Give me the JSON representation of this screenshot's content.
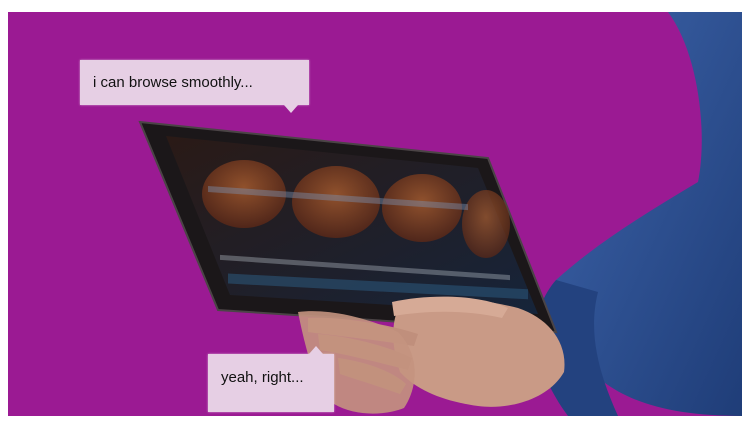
{
  "photo": {
    "background_color": "#9b1a93",
    "sleeve_color": "#2a4f92",
    "tablet_color": "#1b1719",
    "screen_tile_color": "#7a3b1f",
    "skin_color": "#c99a86"
  },
  "captions": {
    "top": "i can browse smoothly...",
    "bottom": "yeah, right..."
  }
}
